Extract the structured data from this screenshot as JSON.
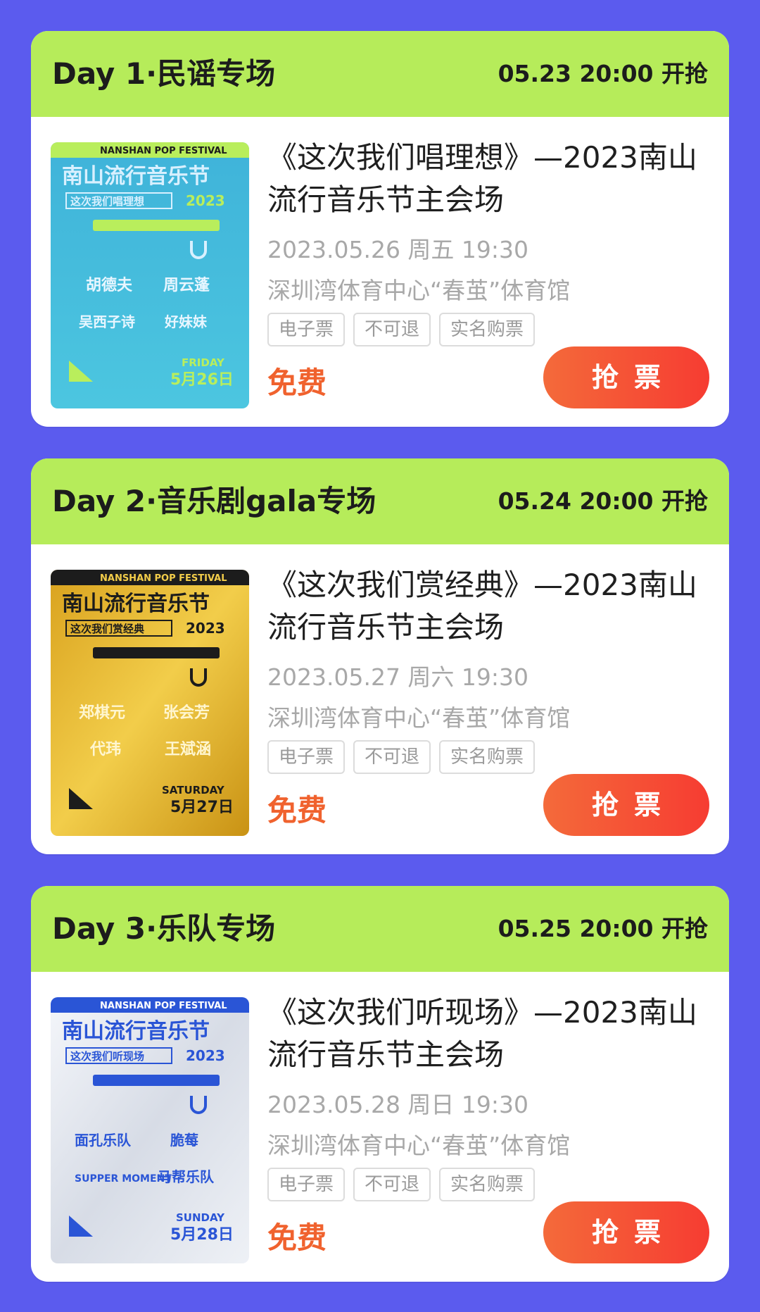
{
  "events": [
    {
      "day_title": "Day 1·民谣专场",
      "sale_time": "05.23 20:00 开抢",
      "title": "《这次我们唱理想》—2023南山流行音乐节主会场",
      "datetime": "2023.05.26 周五 19:30",
      "venue": "深圳湾体育中心“春茧”体育馆",
      "tags": [
        "电子票",
        "不可退",
        "实名购票"
      ],
      "price": "免费",
      "buy_label": "抢票",
      "poster": {
        "festival_en": "NANSHAN POP FESTIVAL",
        "festival_cn": "南山流行音乐节",
        "slogan": "这次我们唱理想",
        "year": "2023",
        "artists": [
          "胡德夫",
          "周云蓬",
          "吴西子诗",
          "好妹妹"
        ],
        "weekday": "FRIDAY",
        "date": "5月26日",
        "theme_color": "#4CB8D8"
      }
    },
    {
      "day_title": "Day 2·音乐剧gala专场",
      "sale_time": "05.24 20:00 开抢",
      "title": "《这次我们赏经典》—2023南山流行音乐节主会场",
      "datetime": "2023.05.27 周六 19:30",
      "venue": "深圳湾体育中心“春茧”体育馆",
      "tags": [
        "电子票",
        "不可退",
        "实名购票"
      ],
      "price": "免费",
      "buy_label": "抢票",
      "poster": {
        "festival_en": "NANSHAN POP FESTIVAL",
        "festival_cn": "南山流行音乐节",
        "slogan": "这次我们赏经典",
        "year": "2023",
        "artists": [
          "郑棋元",
          "张会芳",
          "代玮",
          "王斌涵"
        ],
        "weekday": "SATURDAY",
        "date": "5月27日",
        "theme_color": "#E3B830"
      }
    },
    {
      "day_title": "Day 3·乐队专场",
      "sale_time": "05.25 20:00 开抢",
      "title": "《这次我们听现场》—2023南山流行音乐节主会场",
      "datetime": "2023.05.28 周日 19:30",
      "venue": "深圳湾体育中心“春茧”体育馆",
      "tags": [
        "电子票",
        "不可退",
        "实名购票"
      ],
      "price": "免费",
      "buy_label": "抢票",
      "poster": {
        "festival_en": "NANSHAN POP FESTIVAL",
        "festival_cn": "南山流行音乐节",
        "slogan": "这次我们听现场",
        "year": "2023",
        "artists": [
          "面孔乐队",
          "脆莓",
          "SUPPER MOMENT",
          "马帮乐队"
        ],
        "weekday": "SUNDAY",
        "date": "5月28日",
        "theme_color": "#E4E8F0"
      }
    }
  ],
  "colors": {
    "page_background": "#5B5BEE",
    "header_green": "#B6EC5A",
    "price_orange": "#F0622E",
    "button_gradient_start": "#F46A3A",
    "button_gradient_end": "#F63C32"
  }
}
